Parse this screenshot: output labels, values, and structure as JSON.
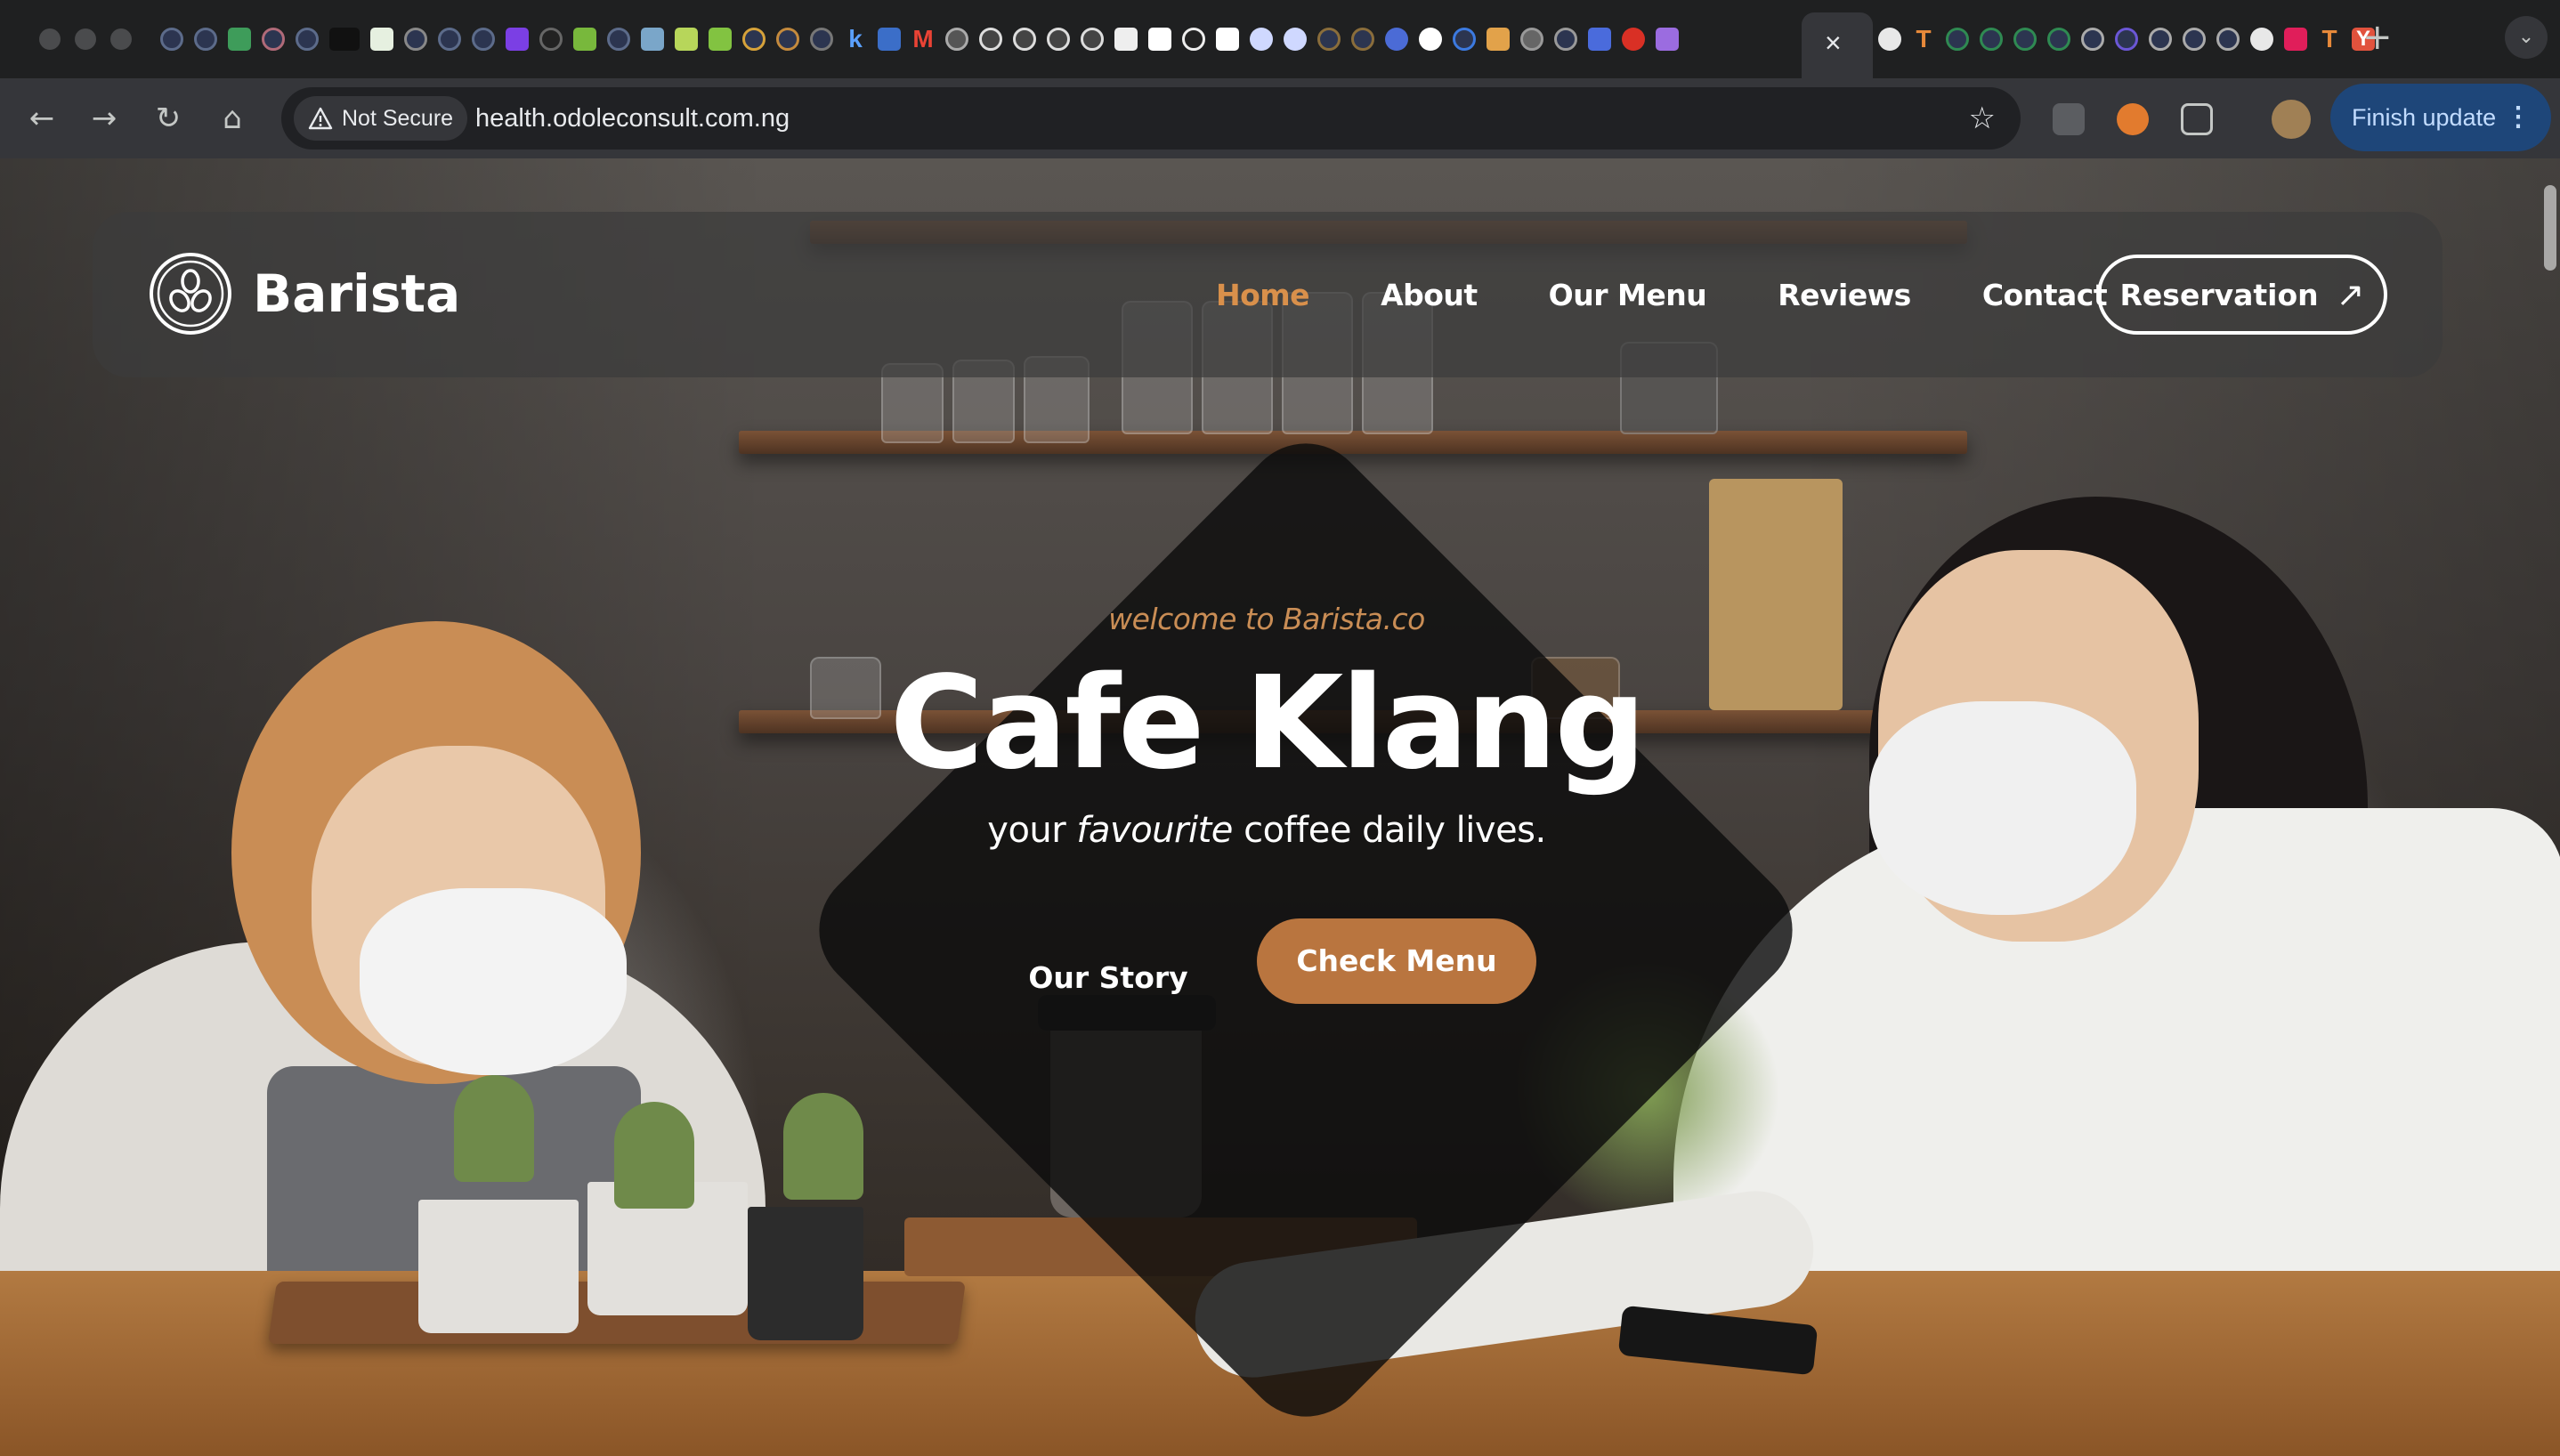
{
  "browser": {
    "active_tab_close": "×",
    "new_tab": "+",
    "tab_menu": "⌄",
    "security_label": "Not Secure",
    "url": "health.odoleconsult.com.ng",
    "finish_update": "Finish update",
    "nav_back": "←",
    "nav_forward": "→",
    "nav_reload": "↻",
    "nav_home": "⌂",
    "bookmark_star": "☆",
    "favicon_letters": [
      "k",
      "M",
      "T",
      "T",
      "Y"
    ]
  },
  "site": {
    "brand": "Barista",
    "nav": [
      {
        "label": "Home",
        "active": true
      },
      {
        "label": "About",
        "active": false
      },
      {
        "label": "Our Menu",
        "active": false
      },
      {
        "label": "Reviews",
        "active": false
      },
      {
        "label": "Contact",
        "active": false
      }
    ],
    "reservation_label": "Reservation",
    "reservation_arrow": "↗"
  },
  "hero": {
    "welcome": "welcome to Barista.co",
    "title": "Cafe Klang",
    "subtitle_pre": "your ",
    "subtitle_em": "favourite",
    "subtitle_post": " coffee daily lives.",
    "our_story": "Our Story",
    "check_menu": "Check Menu"
  },
  "colors": {
    "accent": "#d9904b",
    "button": "#b9753f",
    "welcome": "#c98d55",
    "header_bg": "#3c3c3c",
    "chrome": "#35363a",
    "finish_update_bg": "#1e4679"
  }
}
